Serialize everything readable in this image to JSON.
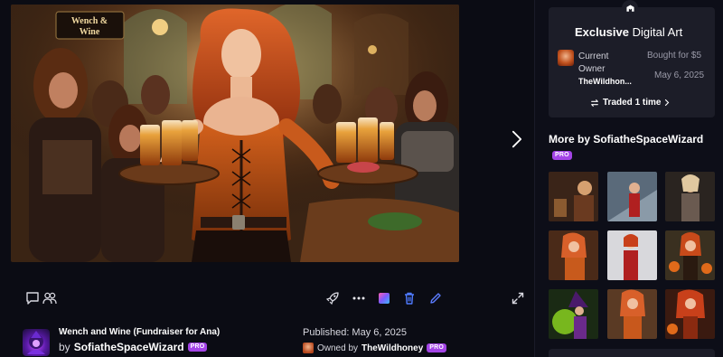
{
  "artwork": {
    "sign_text_line1": "Wench &",
    "sign_text_line2": "Wine"
  },
  "toolbar": {
    "icons": [
      "comment-icon",
      "collaborators-icon",
      "boost-icon",
      "more-icon",
      "gallery-icon",
      "delete-icon",
      "edit-icon",
      "expand-icon"
    ]
  },
  "info": {
    "title": "Wench and Wine (Fundraiser for Ana)",
    "by_prefix": "by",
    "creator": "SofiatheSpaceWizard",
    "pro": "PRO",
    "published": "Published: May 6, 2025",
    "owned_prefix": "Owned by",
    "owner": "TheWildhoney"
  },
  "card": {
    "title_bold": "Exclusive",
    "title_rest": "Digital Art",
    "current_owner_label": "Current Owner",
    "owner_name": "TheWildhon...",
    "bought_for": "Bought for $5",
    "bought_date": "May 6, 2025",
    "traded": "Traded 1 time"
  },
  "more_by": {
    "label": "More by SofiatheSpaceWizard",
    "pro": "PRO"
  },
  "colors": {
    "background": "#0b0c14",
    "card": "#1c1d28",
    "pro_badge": "#a344e6",
    "accent_blue": "#5b7cff",
    "delete_blue": "#4f7bff"
  }
}
